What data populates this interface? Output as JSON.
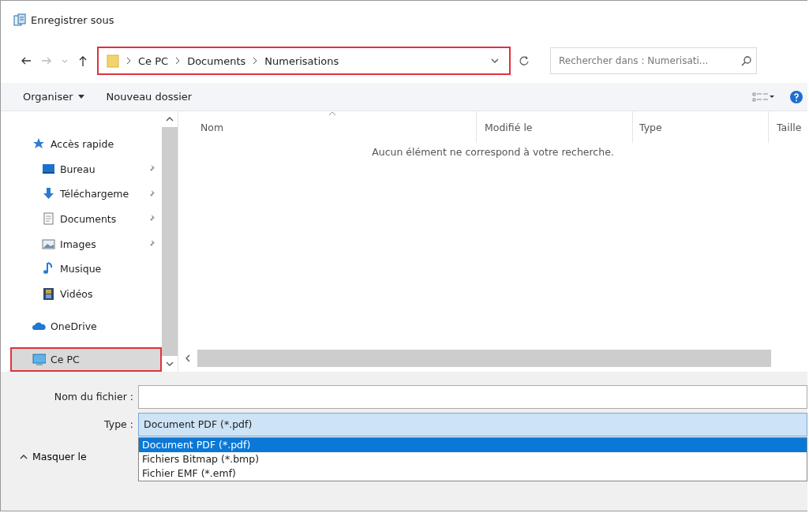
{
  "window": {
    "title": "Enregistrer sous"
  },
  "address_bar": {
    "path": [
      "Ce PC",
      "Documents",
      "Numerisations"
    ],
    "highlighted": true
  },
  "search": {
    "placeholder": "Rechercher dans : Numerisati..."
  },
  "toolbar": {
    "organize": "Organiser",
    "new_folder": "Nouveau dossier"
  },
  "sidebar": {
    "items": [
      {
        "kind": "section",
        "label": "Accès rapide",
        "pinned": false,
        "selected": false,
        "highlighted": false
      },
      {
        "kind": "item",
        "label": "Bureau",
        "pinned": true,
        "selected": false,
        "highlighted": false
      },
      {
        "kind": "item",
        "label": "Téléchargeme",
        "pinned": true,
        "selected": false,
        "highlighted": false
      },
      {
        "kind": "item",
        "label": "Documents",
        "pinned": true,
        "selected": false,
        "highlighted": false
      },
      {
        "kind": "item",
        "label": "Images",
        "pinned": true,
        "selected": false,
        "highlighted": false
      },
      {
        "kind": "item",
        "label": "Musique",
        "pinned": false,
        "selected": false,
        "highlighted": false
      },
      {
        "kind": "item",
        "label": "Vidéos",
        "pinned": false,
        "selected": false,
        "highlighted": false
      },
      {
        "kind": "section",
        "label": "OneDrive",
        "pinned": false,
        "selected": false,
        "highlighted": false
      },
      {
        "kind": "section",
        "label": "Ce PC",
        "pinned": false,
        "selected": true,
        "highlighted": true
      }
    ]
  },
  "table": {
    "columns": [
      "Nom",
      "Modifié le",
      "Type",
      "Taille"
    ],
    "empty_message": "Aucun élément ne correspond à votre recherche."
  },
  "filename": {
    "label": "Nom du fichier :"
  },
  "type": {
    "label": "Type :",
    "value": "Document PDF (*.pdf)",
    "options": [
      {
        "label": "Document PDF (*.pdf)",
        "selected": true
      },
      {
        "label": "Fichiers Bitmap (*.bmp)",
        "selected": false
      },
      {
        "label": "Fichier EMF (*.emf)",
        "selected": false
      }
    ]
  },
  "hide_folders": {
    "label": "Masquer le"
  }
}
